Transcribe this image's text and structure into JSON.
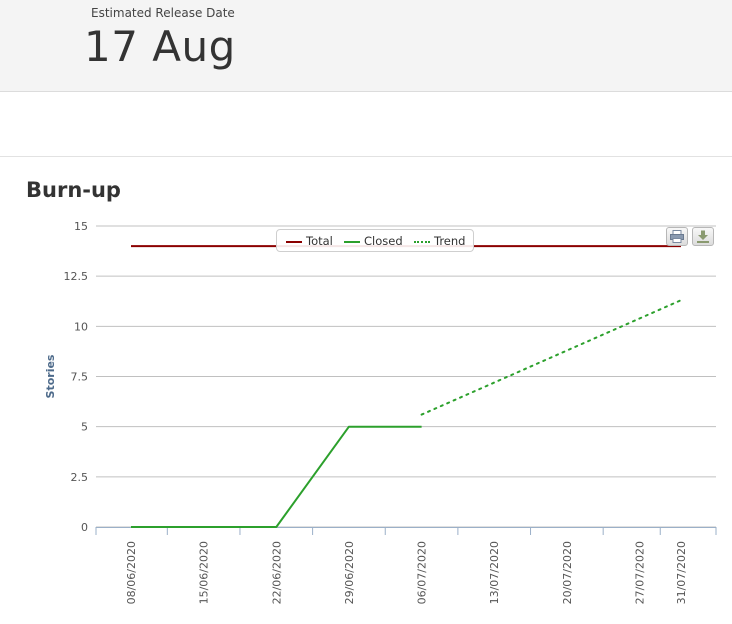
{
  "release": {
    "label": "Estimated Release Date",
    "value": "17 Aug"
  },
  "section": {
    "title": "Burn-up"
  },
  "toolbar": {
    "print_icon": "printer-icon",
    "download_icon": "download-icon"
  },
  "chart_data": {
    "type": "line",
    "title": "",
    "xlabel": "",
    "ylabel": "Stories",
    "ylim": [
      0,
      15
    ],
    "yticks": [
      "0",
      "2.5",
      "5",
      "7.5",
      "10",
      "12.5",
      "15"
    ],
    "xlim": [
      "2020-06-08",
      "2020-07-31"
    ],
    "xticks": [
      "08/06/2020",
      "15/06/2020",
      "22/06/2020",
      "29/06/2020",
      "06/07/2020",
      "13/07/2020",
      "20/07/2020",
      "27/07/2020",
      "31/07/2020"
    ],
    "grid": true,
    "legend_position": "top-center",
    "series": [
      {
        "name": "Total",
        "color": "#8b0000",
        "style": "solid",
        "points": [
          [
            "2020-06-08",
            14
          ],
          [
            "2020-07-31",
            14
          ]
        ]
      },
      {
        "name": "Closed",
        "color": "#2ca02c",
        "style": "solid",
        "points": [
          [
            "2020-06-08",
            0
          ],
          [
            "2020-06-22",
            0
          ],
          [
            "2020-06-29",
            5
          ],
          [
            "2020-07-06",
            5
          ]
        ]
      },
      {
        "name": "Trend",
        "color": "#2ca02c",
        "style": "dotted",
        "points": [
          [
            "2020-07-06",
            5.6
          ],
          [
            "2020-07-31",
            11.3
          ]
        ]
      }
    ]
  }
}
